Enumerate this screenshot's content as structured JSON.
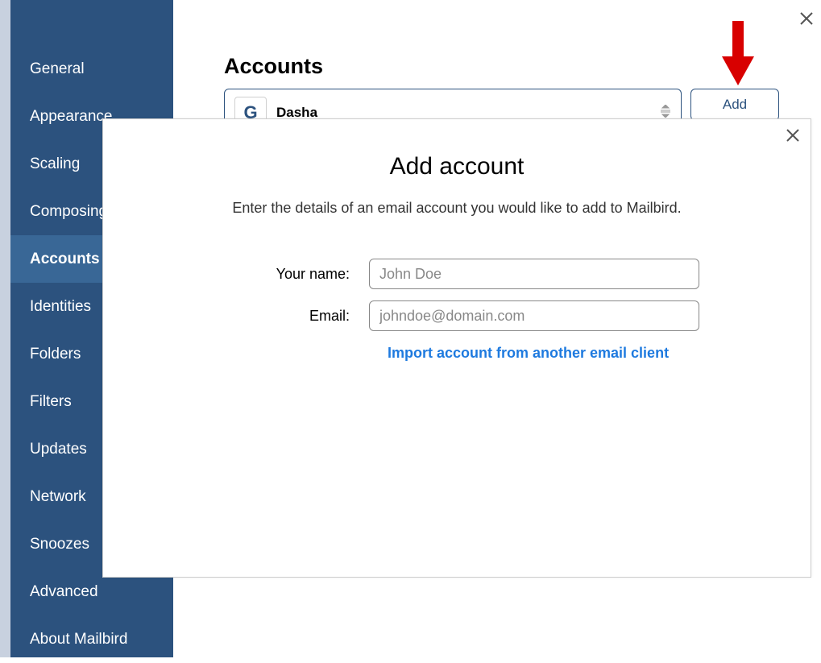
{
  "sidebar": {
    "items": [
      {
        "label": "General",
        "active": false
      },
      {
        "label": "Appearance",
        "active": false
      },
      {
        "label": "Scaling",
        "active": false
      },
      {
        "label": "Composing",
        "active": false
      },
      {
        "label": "Accounts",
        "active": true
      },
      {
        "label": "Identities",
        "active": false
      },
      {
        "label": "Folders",
        "active": false
      },
      {
        "label": "Filters",
        "active": false
      },
      {
        "label": "Updates",
        "active": false
      },
      {
        "label": "Network",
        "active": false
      },
      {
        "label": "Snoozes",
        "active": false
      },
      {
        "label": "Advanced",
        "active": false
      },
      {
        "label": "About Mailbird",
        "active": false
      }
    ]
  },
  "main": {
    "title": "Accounts",
    "account": {
      "avatar_letter": "G",
      "name": "Dasha"
    },
    "add_button": "Add"
  },
  "modal": {
    "title": "Add account",
    "subtitle": "Enter the details of an email account you would like to add to Mailbird.",
    "name_label": "Your name:",
    "name_placeholder": "John Doe",
    "email_label": "Email:",
    "email_placeholder": "johndoe@domain.com",
    "import_link": "Import account from another email client"
  }
}
